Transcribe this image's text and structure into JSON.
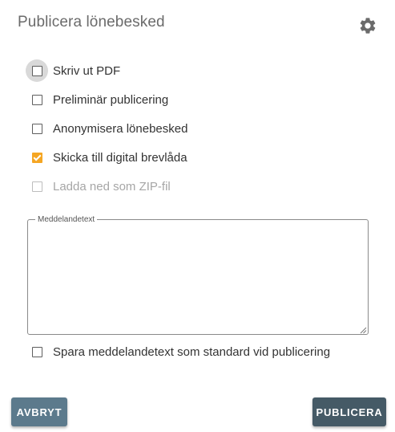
{
  "dialog": {
    "title": "Publicera lönebesked",
    "settings_icon": "gear-icon"
  },
  "options": [
    {
      "label": "Skriv ut PDF",
      "checked": false,
      "disabled": false,
      "focused": true
    },
    {
      "label": "Preliminär publicering",
      "checked": false,
      "disabled": false,
      "focused": false
    },
    {
      "label": "Anonymisera lönebesked",
      "checked": false,
      "disabled": false,
      "focused": false
    },
    {
      "label": "Skicka till digital brevlåda",
      "checked": true,
      "disabled": false,
      "focused": false
    },
    {
      "label": "Ladda ned som ZIP-fil",
      "checked": false,
      "disabled": true,
      "focused": false
    }
  ],
  "message": {
    "legend": "Meddelandetext",
    "value": ""
  },
  "save_default": {
    "label": "Spara meddelandetext som standard vid publicering",
    "checked": false
  },
  "buttons": {
    "cancel": "AVBRYT",
    "publish": "PUBLICERA"
  },
  "colors": {
    "accent_checkbox": "#f5a623",
    "cancel_button": "#5c7a8c",
    "publish_button": "#455a66"
  }
}
